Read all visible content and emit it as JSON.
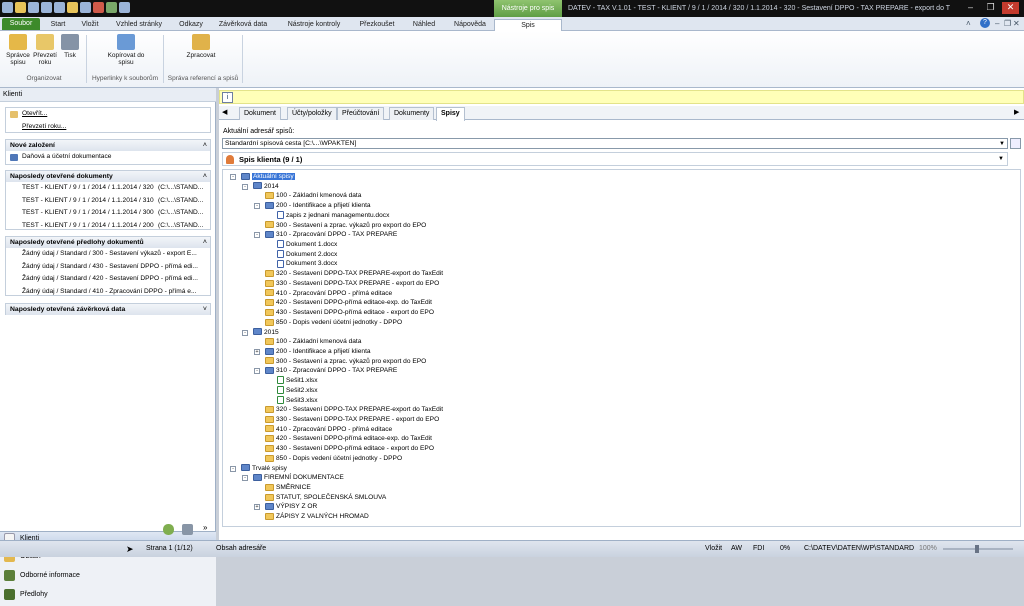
{
  "window": {
    "title": "DATEV - TAX V.1.01 - TEST - KLIENT / 9 / 1 / 2014 / 320 / 1.1.2014 - 320 - Sestavení DPPO - TAX PREPARE - export do T",
    "context_tab_header": "Nástroje pro spis"
  },
  "ribbon": {
    "tabs": [
      "Soubor",
      "Start",
      "Vložit",
      "Vzhled stránky",
      "Odkazy",
      "Závěrková data",
      "Nástroje kontroly",
      "Přezkoušet",
      "Náhled",
      "Nápověda",
      "Spis"
    ],
    "buttons": {
      "spravce": "Správce spisu",
      "prevzeti": "Převzetí roku",
      "tisk": "Tisk",
      "kopirovat": "Kopírovat do spisu",
      "zpracovat": "Zpracovat"
    },
    "groups": {
      "organizovat": "Organizovat",
      "hyperlinky": "Hyperlinky k souborům",
      "sprava": "Správa referencí a spisů"
    }
  },
  "left": {
    "header": "Klienti",
    "open_items": [
      "Otevřít...",
      "Převzetí roku..."
    ],
    "new_section": {
      "title": "Nové založení",
      "items": [
        "Daňová a účetní dokumentace"
      ]
    },
    "recent_docs": {
      "title": "Naposledy otevřené dokumenty",
      "items": [
        {
          "name": "TEST - KLIENT / 9 / 1 / 2014 / 1.1.2014 / 320",
          "path": "(C:\\...\\STAND..."
        },
        {
          "name": "TEST - KLIENT / 9 / 1 / 2014 / 1.1.2014 / 310",
          "path": "(C:\\...\\STAND..."
        },
        {
          "name": "TEST - KLIENT / 9 / 1 / 2014 / 1.1.2014 / 300",
          "path": "(C:\\...\\STAND..."
        },
        {
          "name": "TEST - KLIENT / 9 / 1 / 2014 / 1.1.2014 / 200",
          "path": "(C:\\...\\STAND..."
        }
      ]
    },
    "recent_templates": {
      "title": "Naposledy otevřené předlohy dokumentů",
      "items": [
        "Žádný údaj / Standard / 300 - Sestavení výkazů - export E...",
        "Žádný údaj / Standard / 430 - Sestavení DPPO - přímá edi...",
        "Žádný údaj / Standard / 420 - Sestavení DPPO - přímá edi...",
        "Žádný údaj / Standard / 410 - Zpracování DPPO - přímá e..."
      ]
    },
    "recent_closing": {
      "title": "Naposledy otevřená závěrková data"
    },
    "nav": [
      "Klienti",
      "Obsah",
      "Odborné informace",
      "Předlohy"
    ],
    "chevron": "»"
  },
  "right": {
    "info_icon": "i",
    "tabs": [
      "Dokument",
      "Účty/položky",
      "Přeúčtování",
      "Dokumenty",
      "Spisy"
    ],
    "path_label": "Aktuální adresář spisů:",
    "path_value": "Standardní spisová cesta [C:\\...\\WPAKTEN]",
    "spis_title": "Spis klienta (9 / 1)",
    "tree": [
      {
        "t": "Aktuální spisy",
        "lv": 0,
        "i": "blue",
        "sel": true,
        "tg": "-"
      },
      {
        "t": "2014",
        "lv": 1,
        "i": "blue",
        "tg": "-"
      },
      {
        "t": "100 - Základní kmenová data",
        "lv": 2,
        "i": "fold"
      },
      {
        "t": "200 - Identifikace a přijetí klienta",
        "lv": 2,
        "i": "blue",
        "tg": "-"
      },
      {
        "t": "zapis z jednani managementu.docx",
        "lv": 3,
        "i": "doc"
      },
      {
        "t": "300 - Sestavení a zprac. výkazů pro export do EPO",
        "lv": 2,
        "i": "fold"
      },
      {
        "t": "310 - Zpracování DPPO - TAX PREPARE",
        "lv": 2,
        "i": "blue",
        "tg": "-"
      },
      {
        "t": "Dokument 1.docx",
        "lv": 3,
        "i": "doc"
      },
      {
        "t": "Dokument 2.docx",
        "lv": 3,
        "i": "doc"
      },
      {
        "t": "Dokument 3.docx",
        "lv": 3,
        "i": "doc"
      },
      {
        "t": "320 - Sestavení DPPO-TAX PREPARE-export do TaxEdit",
        "lv": 2,
        "i": "fold"
      },
      {
        "t": "330 - Sestavení DPPO-TAX PREPARE - export do EPO",
        "lv": 2,
        "i": "fold"
      },
      {
        "t": "410 - Zpracování DPPO - přímá editace",
        "lv": 2,
        "i": "fold"
      },
      {
        "t": "420 - Sestavení DPPO-přímá editace-exp. do TaxEdit",
        "lv": 2,
        "i": "fold"
      },
      {
        "t": "430 - Sestavení DPPO-přímá editace - export do EPO",
        "lv": 2,
        "i": "fold"
      },
      {
        "t": "850 - Dopis vedení účetní jednotky - DPPO",
        "lv": 2,
        "i": "fold"
      },
      {
        "t": "2015",
        "lv": 1,
        "i": "blue",
        "tg": "-"
      },
      {
        "t": "100 - Základní kmenová data",
        "lv": 2,
        "i": "fold"
      },
      {
        "t": "200 - Identifikace a přijetí klienta",
        "lv": 2,
        "i": "blue",
        "tg": "+"
      },
      {
        "t": "300 - Sestavení a zprac. výkazů pro export do EPO",
        "lv": 2,
        "i": "fold"
      },
      {
        "t": "310 - Zpracování DPPO - TAX PREPARE",
        "lv": 2,
        "i": "blue",
        "tg": "-"
      },
      {
        "t": "Sešit1.xlsx",
        "lv": 3,
        "i": "xls"
      },
      {
        "t": "Sešit2.xlsx",
        "lv": 3,
        "i": "xls"
      },
      {
        "t": "Sešit3.xlsx",
        "lv": 3,
        "i": "xls"
      },
      {
        "t": "320 - Sestavení DPPO-TAX PREPARE-export do TaxEdit",
        "lv": 2,
        "i": "fold"
      },
      {
        "t": "330 - Sestavení DPPO-TAX PREPARE - export do EPO",
        "lv": 2,
        "i": "fold"
      },
      {
        "t": "410 - Zpracování DPPO - přímá editace",
        "lv": 2,
        "i": "fold"
      },
      {
        "t": "420 - Sestavení DPPO-přímá editace-exp. do TaxEdit",
        "lv": 2,
        "i": "fold"
      },
      {
        "t": "430 - Sestavení DPPO-přímá editace - export do EPO",
        "lv": 2,
        "i": "fold"
      },
      {
        "t": "850 - Dopis vedení účetní jednotky - DPPO",
        "lv": 2,
        "i": "fold"
      },
      {
        "t": "Trvalé spisy",
        "lv": 0,
        "i": "blue",
        "tg": "-"
      },
      {
        "t": "FIREMNÍ DOKUMENTACE",
        "lv": 1,
        "i": "blue",
        "tg": "-"
      },
      {
        "t": "SMĚRNICE",
        "lv": 2,
        "i": "fold"
      },
      {
        "t": "STATUT, SPOLEČENSKÁ SMLOUVA",
        "lv": 2,
        "i": "fold"
      },
      {
        "t": "VÝPISY Z OR",
        "lv": 2,
        "i": "blue",
        "tg": "+"
      },
      {
        "t": "ZÁPISY Z VALNÝCH HROMAD",
        "lv": 2,
        "i": "fold"
      }
    ]
  },
  "status": {
    "page": "Strana 1 (1/12)",
    "content": "Obsah adresáře",
    "insert": "Vložit",
    "aw": "AW",
    "fdi": "FDI",
    "percent": "0%",
    "path": "C:\\DATEV\\DATEN\\WP\\STANDARD",
    "zoom": "100%"
  },
  "colors": {
    "accent": "#3875d7",
    "file_tab": "#3d8a2a",
    "context": "#5f9e45",
    "info": "#ffffb8"
  }
}
